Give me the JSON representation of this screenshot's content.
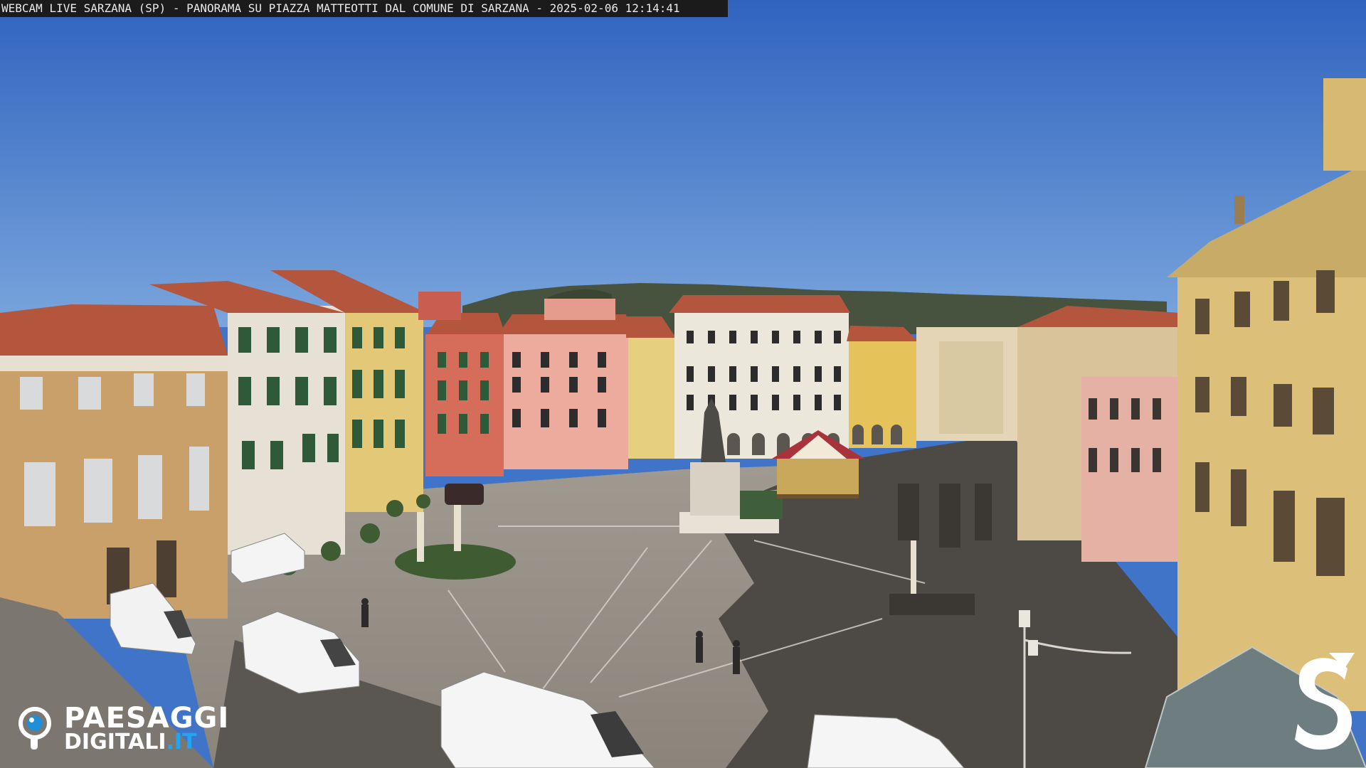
{
  "overlay": {
    "title": "WEBCAM LIVE SARZANA (SP) - PANORAMA SU PIAZZA MATTEOTTI DAL COMUNE DI SARZANA - 2025-02-06  12:14:41"
  },
  "logo": {
    "line1": "PAESAGGI",
    "line2_main": "DIGITALI",
    "line2_suffix": ".IT",
    "accent_color": "#24a3ef",
    "right_mark": "S"
  },
  "scene": {
    "sky_color": "#3f74c8",
    "pavement_color": "#8f8a82",
    "shadow_color": "#4a4744"
  }
}
